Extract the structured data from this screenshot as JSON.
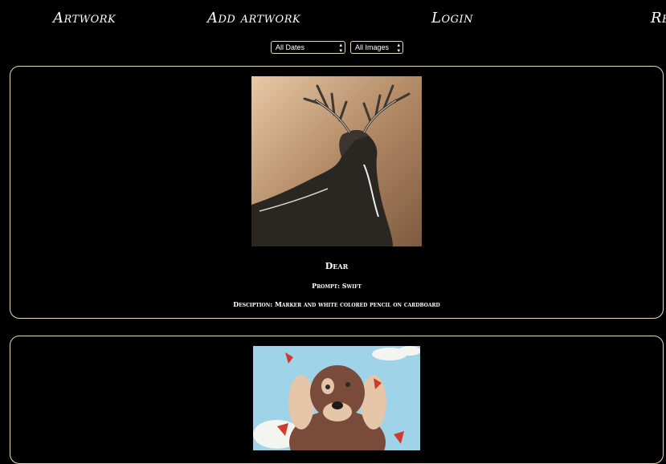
{
  "nav": {
    "items": [
      {
        "label": "Artwork"
      },
      {
        "label": "Add artwork"
      },
      {
        "label": "Login"
      },
      {
        "label": "Re"
      }
    ]
  },
  "filters": {
    "date": {
      "selected": "All Dates"
    },
    "images": {
      "selected": "All Images"
    }
  },
  "artworks": [
    {
      "title": "Dear",
      "prompt": "Prompt: Swift",
      "description": "Desciption: Marker and white colored pencil on cardboard",
      "image": "deer-stag-drawing"
    },
    {
      "image": "dog-with-butterflies-painting"
    }
  ],
  "colors": {
    "background": "#000000",
    "border": "#e8d7b5",
    "text": "#ffffff"
  }
}
